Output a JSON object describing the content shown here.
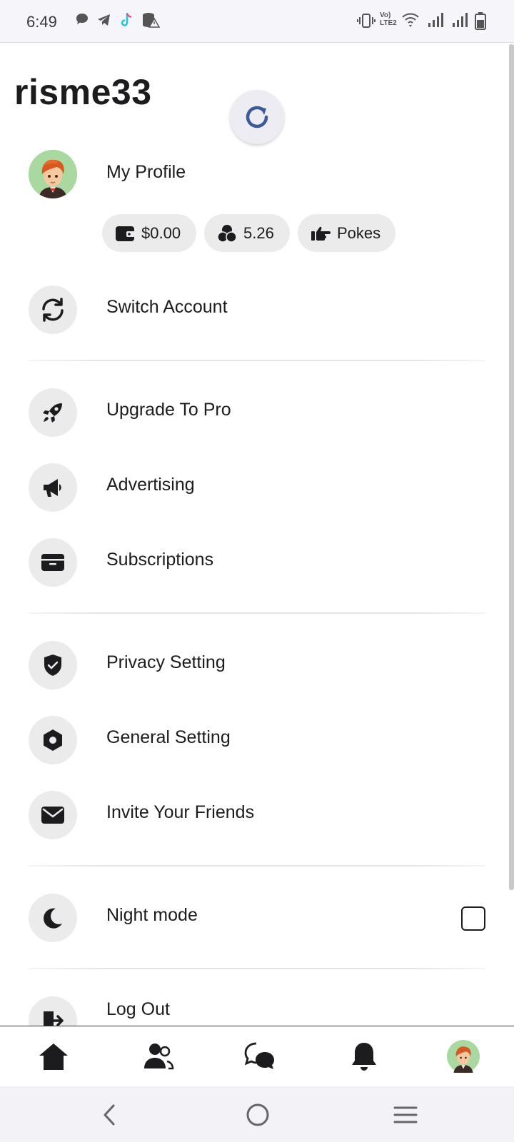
{
  "status_bar": {
    "time": "6:49",
    "left_icons": [
      "chat-bubble-icon",
      "telegram-icon",
      "tiktok-icon",
      "database-warning-icon"
    ],
    "right_icons": [
      "vibrate-icon",
      "volte-icon",
      "wifi-icon",
      "signal-icon",
      "signal-icon",
      "battery-icon"
    ],
    "volte_label": "Vo) LTE2"
  },
  "header": {
    "username": "risme33"
  },
  "profile": {
    "label": "My Profile",
    "chips": [
      {
        "icon": "wallet-icon",
        "label": "$0.00"
      },
      {
        "icon": "points-icon",
        "label": "5.26"
      },
      {
        "icon": "poke-hand-icon",
        "label": "Pokes"
      }
    ]
  },
  "menu": {
    "switch_account": "Switch Account",
    "upgrade": "Upgrade To Pro",
    "advertising": "Advertising",
    "subscriptions": "Subscriptions",
    "privacy": "Privacy Setting",
    "general": "General Setting",
    "invite": "Invite Your Friends",
    "night_mode": "Night mode",
    "night_mode_enabled": false,
    "logout": "Log Out"
  },
  "bottom_nav": [
    "home-icon",
    "friends-icon",
    "messages-icon",
    "notifications-icon",
    "profile-avatar"
  ],
  "system_nav": [
    "back-icon",
    "home-circle-icon",
    "recents-icon"
  ],
  "colors": {
    "accent": "#3b5a9a",
    "chip_bg": "#ebebeb",
    "avatar_bg": "#a9d9a0"
  }
}
